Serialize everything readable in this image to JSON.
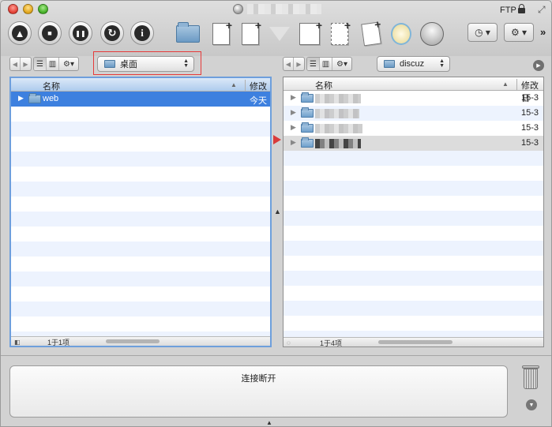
{
  "titlebar": {
    "protocol_label": "FTP",
    "fullscreen_glyph": "⤢"
  },
  "toolbar": {
    "buttons": [
      {
        "name": "disconnect",
        "glyph": "▲"
      },
      {
        "name": "stop",
        "glyph": "■"
      },
      {
        "name": "pause",
        "glyph": "❚❚"
      },
      {
        "name": "refresh",
        "glyph": "↻"
      },
      {
        "name": "info",
        "glyph": "i"
      }
    ],
    "history_glyph": "◷ ▾",
    "settings_glyph": "⚙ ▾",
    "more_glyph": "»"
  },
  "left_pane": {
    "path": "桌面",
    "column_name": "名称",
    "column_date": "修改日",
    "rows": [
      {
        "name": "web",
        "date": "今天",
        "selected": true
      }
    ],
    "footer_count": "1于1项"
  },
  "right_pane": {
    "path": "discuz",
    "column_name": "名称",
    "column_date": "修改日",
    "rows": [
      {
        "date": "15-3"
      },
      {
        "date": "15-3"
      },
      {
        "date": "15-3"
      },
      {
        "date": "15-3"
      }
    ],
    "footer_count": "1于4项"
  },
  "log": {
    "status_text": "连接断开"
  },
  "colors": {
    "selection": "#3d80df",
    "alt_row": "#edf3fe",
    "highlight_box": "#e63a3a"
  }
}
